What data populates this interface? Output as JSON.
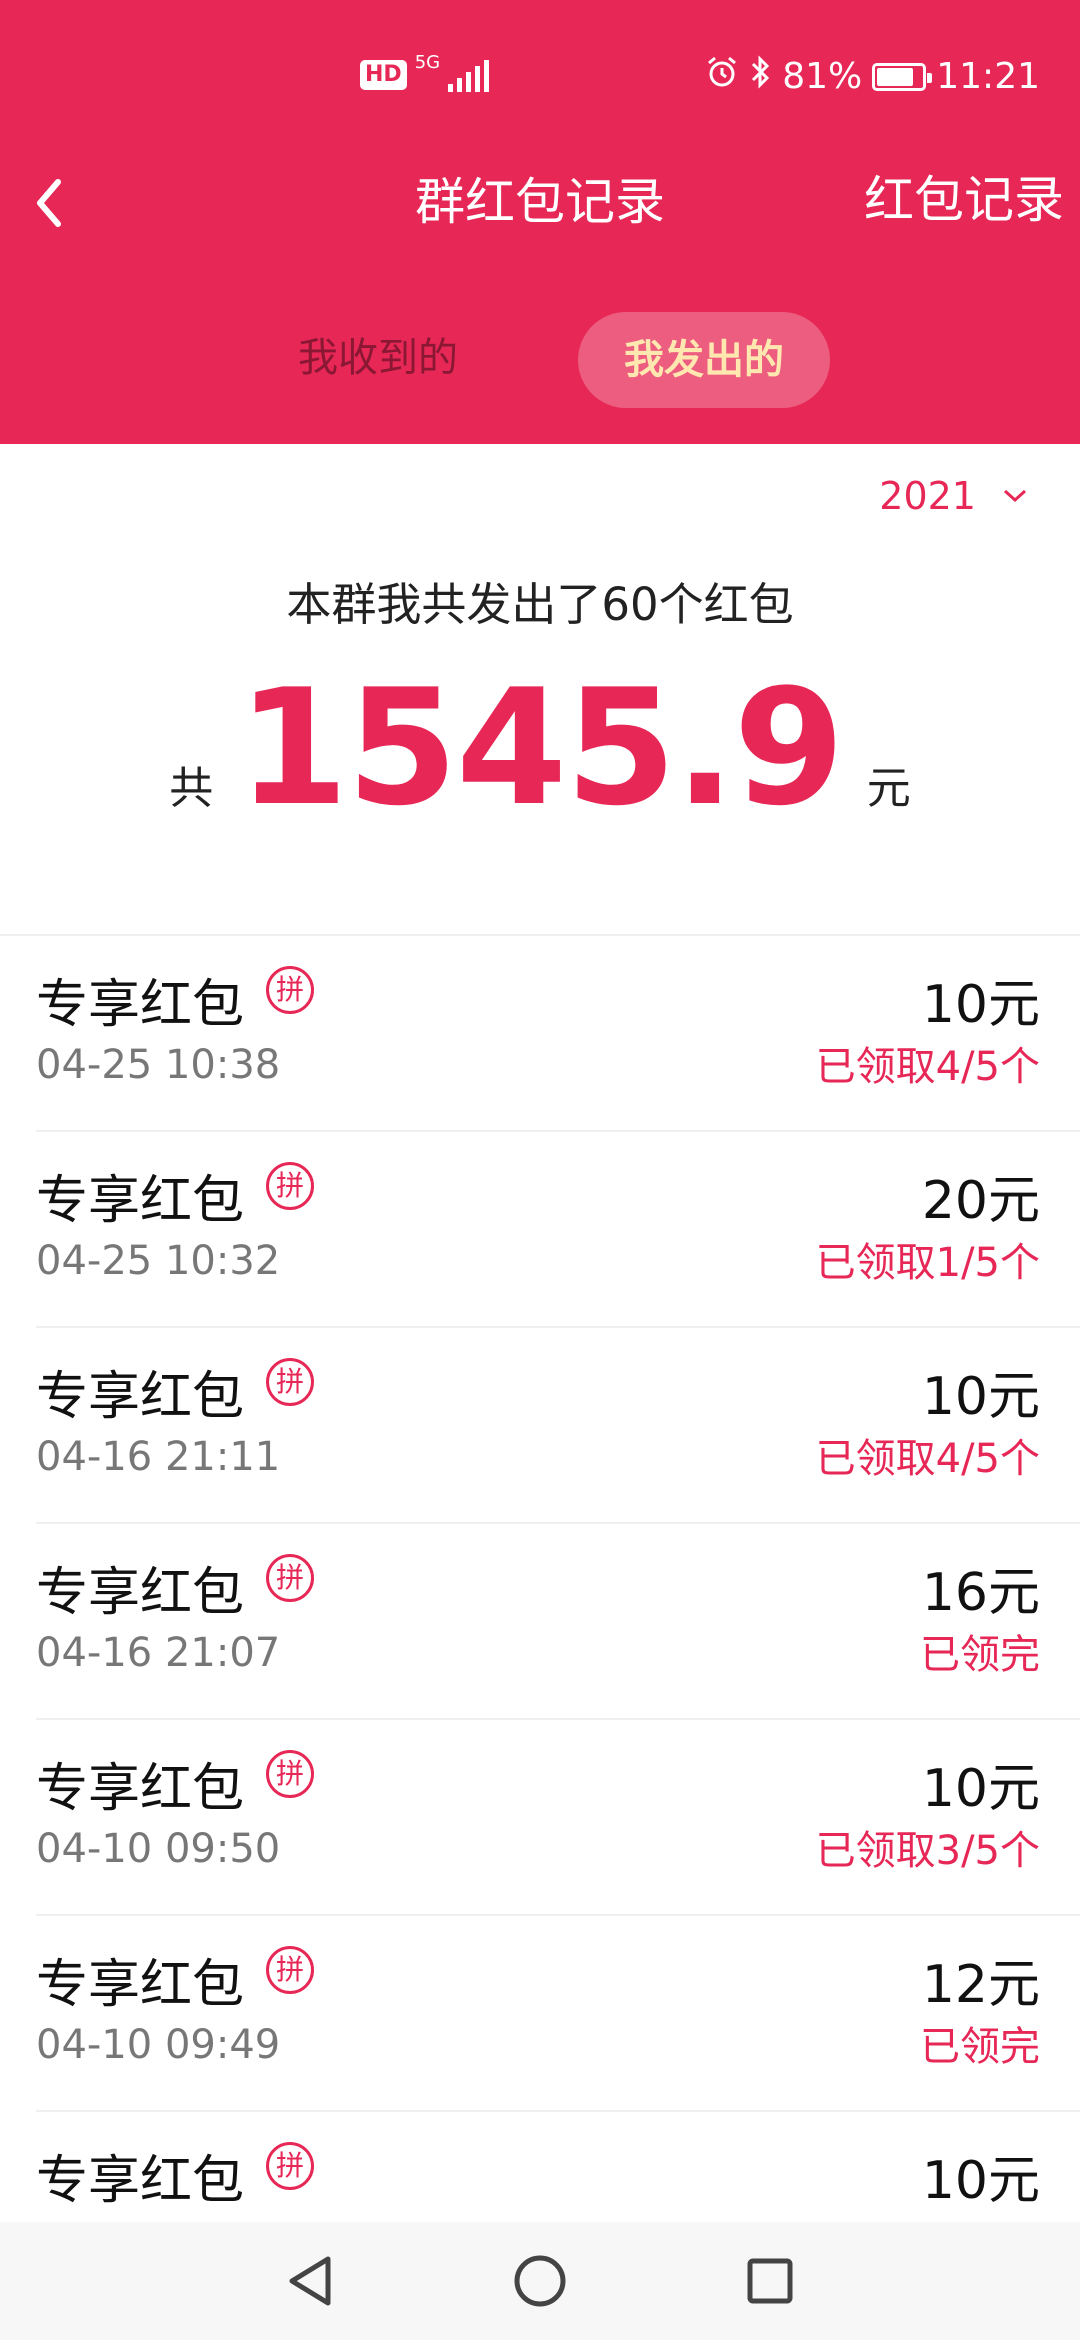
{
  "status_bar": {
    "hd": "HD",
    "network": "5G",
    "battery_text": "81%",
    "battery_level": 0.81,
    "time": "11:21",
    "alarm_icon": "alarm-icon",
    "bluetooth_icon": "bluetooth-icon"
  },
  "header": {
    "title": "群红包记录",
    "right_link": "红包记录",
    "back_icon": "back-icon"
  },
  "tabs": [
    {
      "label": "我收到的",
      "active": false
    },
    {
      "label": "我发出的",
      "active": true
    }
  ],
  "year_selector": {
    "value": "2021",
    "icon": "chevron-down-icon"
  },
  "summary": {
    "text": "本群我共发出了60个红包",
    "total_prefix": "共",
    "total_amount": "1545.9",
    "total_unit": "元"
  },
  "items": [
    {
      "title": "专享红包",
      "badge": "拼",
      "time": "04-25 10:38",
      "amount": "10元",
      "status": "已领取4/5个"
    },
    {
      "title": "专享红包",
      "badge": "拼",
      "time": "04-25 10:32",
      "amount": "20元",
      "status": "已领取1/5个"
    },
    {
      "title": "专享红包",
      "badge": "拼",
      "time": "04-16 21:11",
      "amount": "10元",
      "status": "已领取4/5个"
    },
    {
      "title": "专享红包",
      "badge": "拼",
      "time": "04-16 21:07",
      "amount": "16元",
      "status": "已领完"
    },
    {
      "title": "专享红包",
      "badge": "拼",
      "time": "04-10 09:50",
      "amount": "10元",
      "status": "已领取3/5个"
    },
    {
      "title": "专享红包",
      "badge": "拼",
      "time": "04-10 09:49",
      "amount": "12元",
      "status": "已领完"
    },
    {
      "title": "专享红包",
      "badge": "拼",
      "time": "",
      "amount": "10元",
      "status": ""
    }
  ],
  "nav_bar": {
    "back": "nav-back-icon",
    "home": "nav-home-icon",
    "recents": "nav-recents-icon"
  },
  "colors": {
    "brand": "#E72756",
    "tab_active_text": "#FFE7B0",
    "text_primary": "#111111",
    "text_secondary": "#777777"
  }
}
